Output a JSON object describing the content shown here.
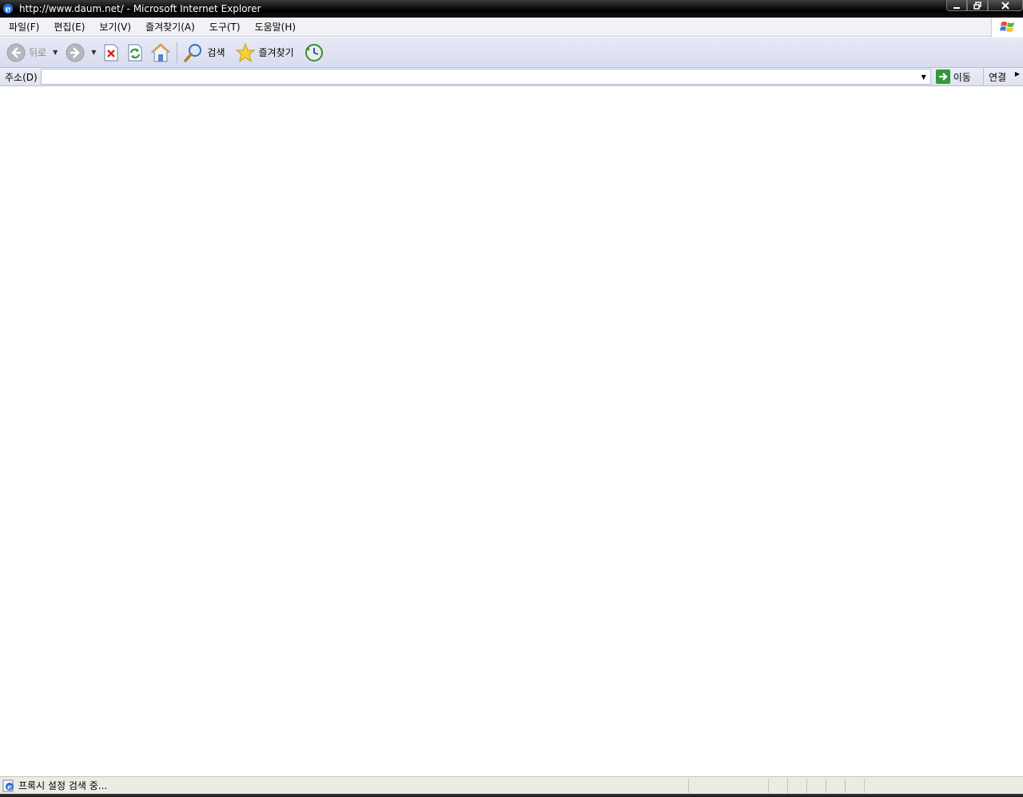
{
  "window": {
    "title": "http://www.daum.net/ - Microsoft Internet Explorer"
  },
  "menu": {
    "items": [
      "파일(F)",
      "편집(E)",
      "보기(V)",
      "즐겨찾기(A)",
      "도구(T)",
      "도움말(H)"
    ]
  },
  "toolbar": {
    "back_label": "뒤로",
    "search_label": "검색",
    "favorites_label": "즐겨찾기"
  },
  "address": {
    "label": "주소(D)",
    "value": "",
    "go_label": "이동",
    "links_label": "연결"
  },
  "status": {
    "text": "프록시 설정 검색 중..."
  }
}
